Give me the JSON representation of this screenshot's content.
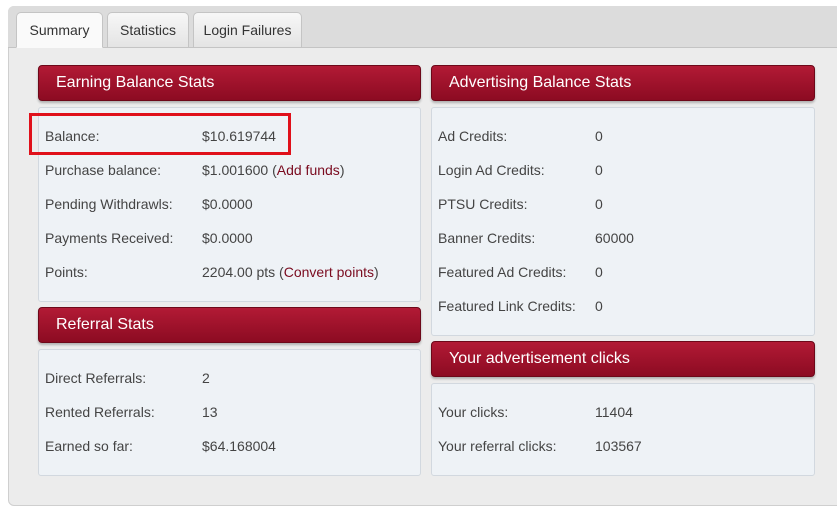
{
  "tabs": [
    {
      "label": "Summary"
    },
    {
      "label": "Statistics"
    },
    {
      "label": "Login Failures"
    }
  ],
  "earning": {
    "title": "Earning Balance Stats",
    "rows": [
      {
        "label": "Balance:",
        "value": "$10.619744"
      },
      {
        "label": "Purchase balance:",
        "value": "$1.001600",
        "link": "Add funds"
      },
      {
        "label": "Pending Withdrawls:",
        "value": "$0.0000"
      },
      {
        "label": "Payments Received:",
        "value": "$0.0000"
      },
      {
        "label": "Points:",
        "value": "2204.00 pts",
        "link": "Convert points"
      }
    ]
  },
  "referral": {
    "title": "Referral Stats",
    "rows": [
      {
        "label": "Direct Referrals:",
        "value": "2"
      },
      {
        "label": "Rented Referrals:",
        "value": "13"
      },
      {
        "label": "Earned so far:",
        "value": "$64.168004"
      }
    ]
  },
  "advertising": {
    "title": "Advertising Balance Stats",
    "rows": [
      {
        "label": "Ad Credits:",
        "value": "0"
      },
      {
        "label": "Login Ad Credits:",
        "value": "0"
      },
      {
        "label": "PTSU Credits:",
        "value": "0"
      },
      {
        "label": "Banner Credits:",
        "value": "60000"
      },
      {
        "label": "Featured Ad Credits:",
        "value": "0"
      },
      {
        "label": "Featured Link Credits:",
        "value": "0"
      }
    ]
  },
  "clicks": {
    "title": "Your advertisement clicks",
    "rows": [
      {
        "label": "Your clicks:",
        "value": "11404"
      },
      {
        "label": "Your referral clicks:",
        "value": "103567"
      }
    ]
  },
  "punct": {
    "open": " (",
    "close": ")"
  },
  "colors": {
    "header": "#9e1129",
    "highlight": "#e0101a",
    "panel_bg": "#eef2f6"
  }
}
